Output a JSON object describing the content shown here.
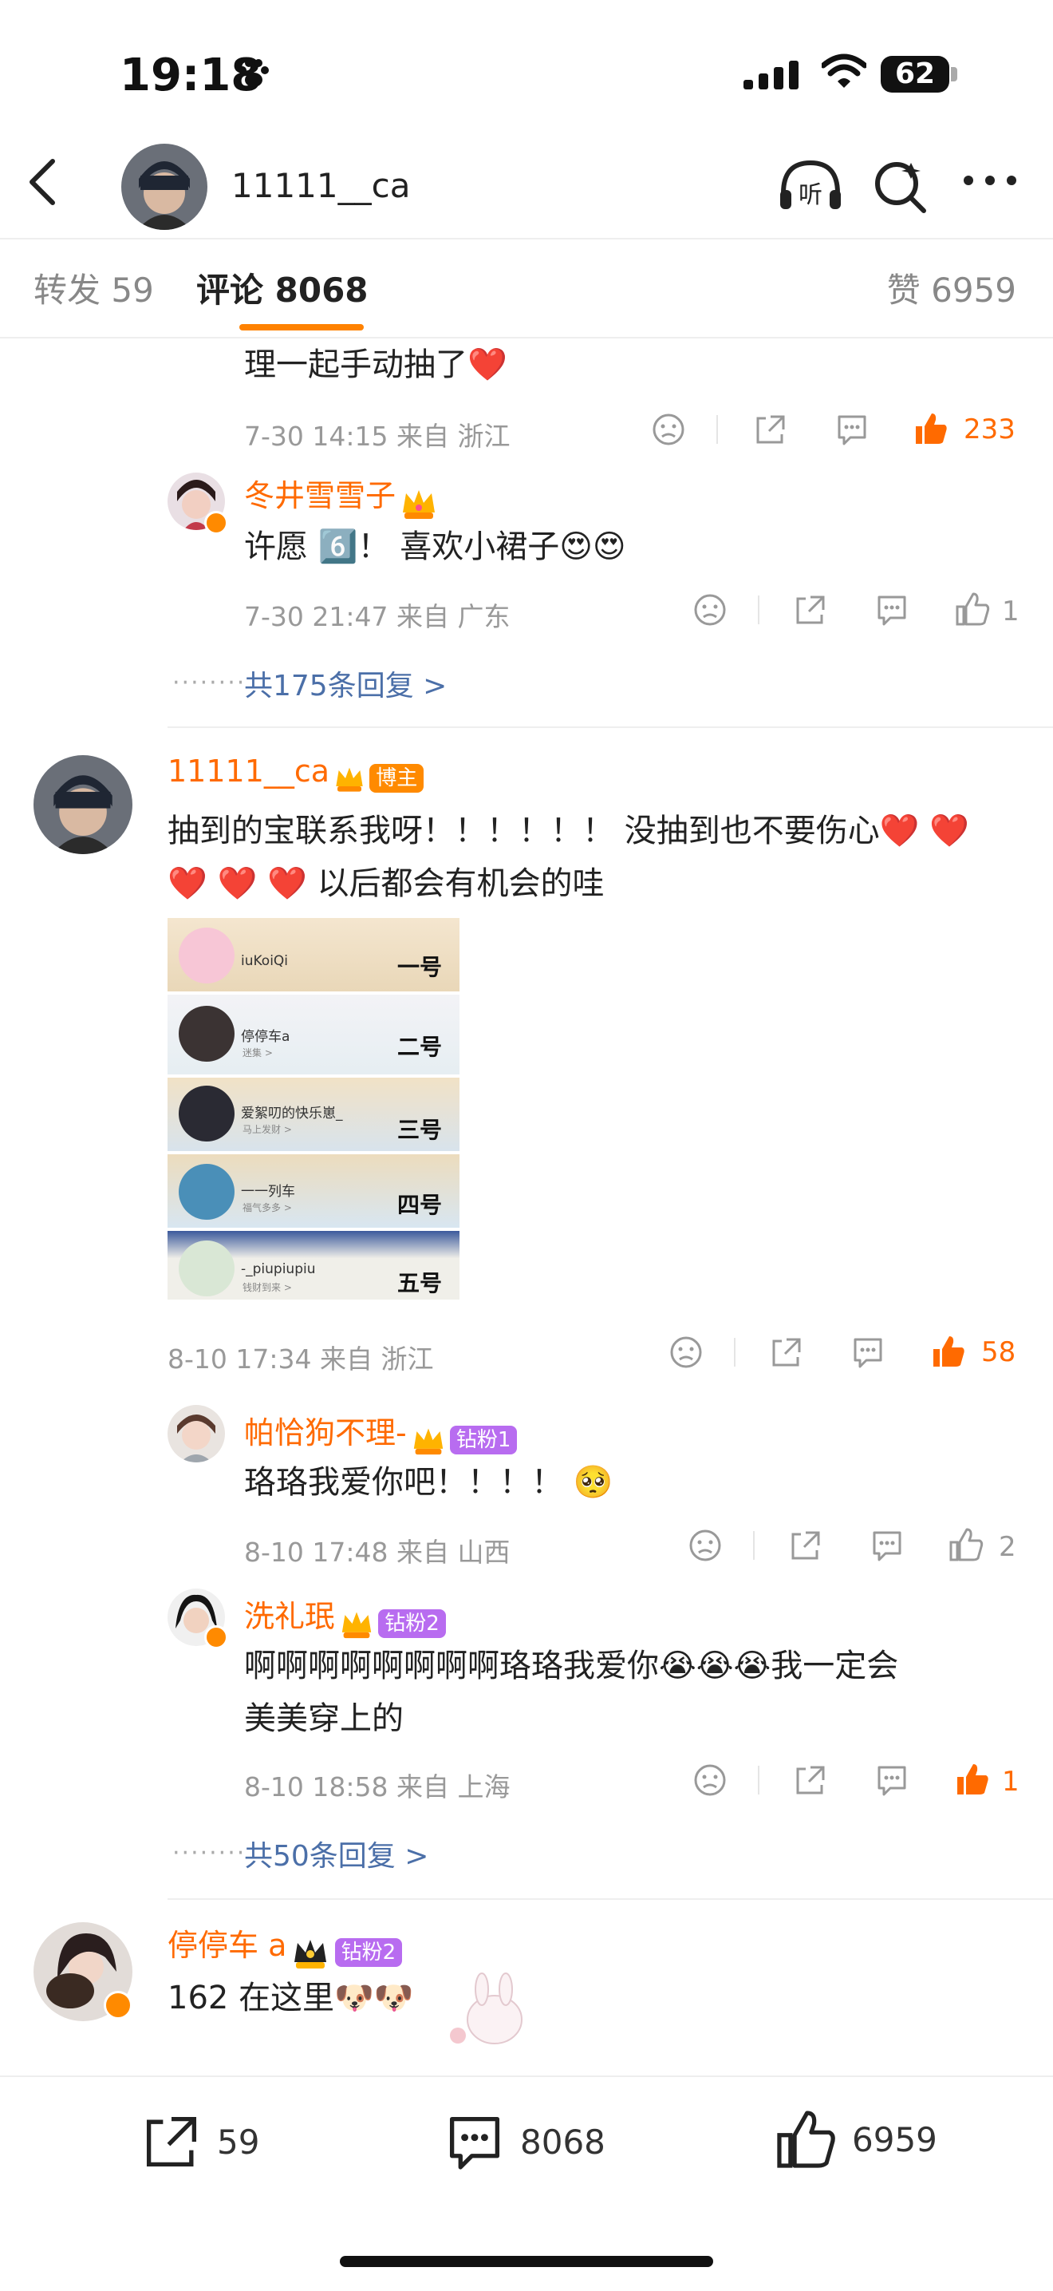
{
  "status": {
    "time": "19:18",
    "battery": "62"
  },
  "header": {
    "username": "11111__ca"
  },
  "tabs": {
    "repost": "转发 59",
    "comments": "评论 8068",
    "likes": "赞 6959"
  },
  "comments": [
    {
      "text": "理一起手动抽了❤️",
      "meta": "7-30 14:15 来自 浙江",
      "likes": "233",
      "replies": [
        {
          "name": "冬井雪雪子",
          "text": "许愿 6️⃣！ 喜欢小裙子😍😍",
          "meta": "7-30 21:47 来自 广东",
          "likes": "1"
        }
      ],
      "more_replies": "共175条回复 >"
    },
    {
      "name": "11111__ca",
      "badge": "博主",
      "text_line1": "抽到的宝联系我呀！！！！！！ 没抽到也不要伤心❤️ ❤️",
      "text_line2": "❤️ ❤️ ❤️ 以后都会有机会的哇",
      "image_entries": [
        {
          "name": "iuKoiQi",
          "label": "一号",
          "sub": ""
        },
        {
          "name": "停停车a",
          "label": "二号",
          "sub": "迷集 >"
        },
        {
          "name": "爱絮叨的快乐崽_",
          "label": "三号",
          "sub": "马上发财 >"
        },
        {
          "name": "一一列车",
          "label": "四号",
          "sub": "福气多多 >"
        },
        {
          "name": "-_piupiupiu",
          "label": "五号",
          "sub": "钱财到来 >"
        }
      ],
      "meta": "8-10 17:34 来自 浙江",
      "likes": "58",
      "replies": [
        {
          "name": "帕恰狗不理-",
          "badge": "钻粉1",
          "text": "珞珞我爱你吧！！！！ 🥺",
          "meta": "8-10 17:48 来自 山西",
          "likes": "2"
        },
        {
          "name": "洗礼珉",
          "badge": "钻粉2",
          "text_line1": "啊啊啊啊啊啊啊啊珞珞我爱你😭😭😭我一定会",
          "text_line2": "美美穿上的",
          "meta": "8-10 18:58 来自 上海",
          "likes": "1"
        }
      ],
      "more_replies": "共50条回复 >"
    },
    {
      "name": "停停车 a",
      "badge": "钻粉2",
      "text": "162 在这里🐶🐶"
    }
  ],
  "bottom": {
    "repost": "59",
    "comment": "8068",
    "like": "6959"
  },
  "colors": {
    "accent": "#ff8200",
    "name": "#ff6a00",
    "link": "#4b6fa8",
    "fan_badge": "#b86cf0"
  },
  "icons": [
    "back-icon",
    "listen-icon",
    "search-icon",
    "more-icon",
    "dislike-icon",
    "share-icon",
    "comment-icon",
    "like-icon"
  ]
}
